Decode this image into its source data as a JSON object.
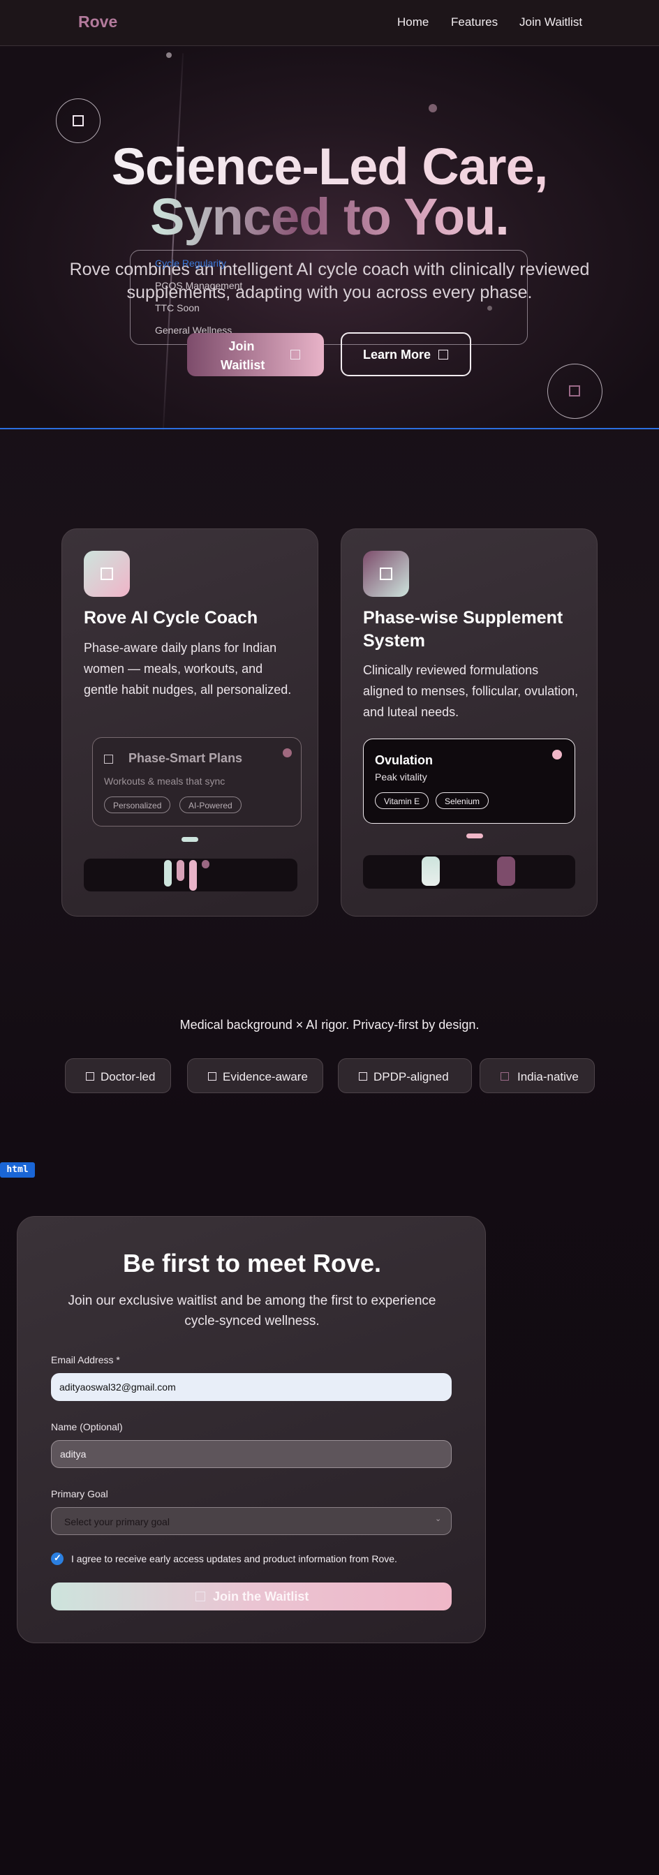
{
  "nav": {
    "logo": "Rove",
    "links": [
      "Home",
      "Features",
      "Join Waitlist"
    ]
  },
  "hero": {
    "title_line1": "Science-Led Care,",
    "title_line2": "Synced to You.",
    "subtitle": "Rove combines an intelligent AI cycle coach with clinically reviewed supplements, adapting with you across every phase.",
    "goal_options": [
      "Cycle Regularity",
      "PCOS Management",
      "TTC Soon",
      "General Wellness"
    ],
    "join_label": "Join Waitlist",
    "learn_label": "Learn More"
  },
  "features": [
    {
      "title": "Rove AI Cycle Coach",
      "text": "Phase-aware daily plans for Indian women — meals, workouts, and gentle habit nudges, all personalized.",
      "mini_title": "Phase-Smart Plans",
      "mini_sub": "Workouts & meals that sync",
      "mini_pills": [
        "Personalized",
        "AI-Powered"
      ]
    },
    {
      "title": "Phase-wise Supplement System",
      "text": "Clinically reviewed formulations aligned to menses, follicular, ovulation, and luteal needs.",
      "mini_title": "Ovulation",
      "mini_sub": "Peak vitality",
      "mini_pills": [
        "Vitamin E",
        "Selenium"
      ]
    }
  ],
  "trust": {
    "line": "Medical background × AI rigor. Privacy-first by design.",
    "badges": [
      "Doctor-led",
      "Evidence-aware",
      "DPDP-aligned",
      "India-native"
    ]
  },
  "debug_tag": "html",
  "form": {
    "title": "Be first to meet Rove.",
    "subtitle": "Join our exclusive waitlist and be among the first to experience cycle-synced wellness.",
    "email_label": "Email Address *",
    "email_value": "adityaoswal32@gmail.com",
    "name_label": "Name (Optional)",
    "name_value": "aditya",
    "goal_label": "Primary Goal",
    "goal_placeholder": "Select your primary goal",
    "consent": "I agree to receive early access updates and product information from Rove.",
    "submit": "Join the Waitlist"
  },
  "colors": {
    "accent_blue": "#2b6fe0",
    "brand_pink": "#e8b3c8",
    "brand_plum": "#7d4c6b",
    "mint": "#cde4dd"
  }
}
